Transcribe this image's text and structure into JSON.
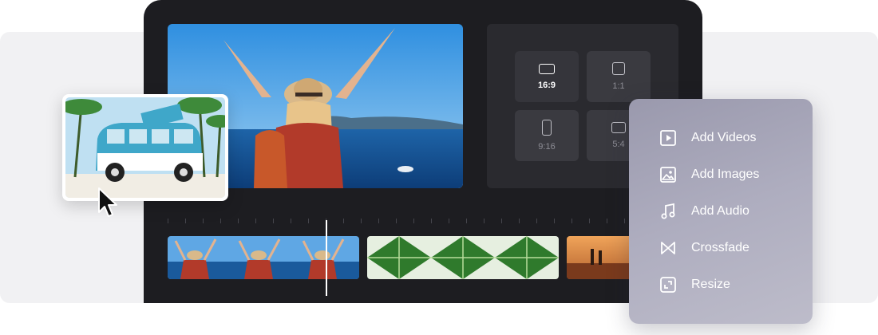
{
  "aspect_ratios": [
    {
      "label": "16:9",
      "icon": "landscape-rectangle-icon",
      "active": true
    },
    {
      "label": "1:1",
      "icon": "square-icon",
      "active": false
    },
    {
      "label": "9:16",
      "icon": "portrait-rectangle-icon",
      "active": false
    },
    {
      "label": "5:4",
      "icon": "rectangle-icon",
      "active": false
    }
  ],
  "menu": {
    "items": [
      {
        "label": "Add Videos",
        "icon": "play-icon"
      },
      {
        "label": "Add Images",
        "icon": "image-icon"
      },
      {
        "label": "Add Audio",
        "icon": "music-note-icon"
      },
      {
        "label": "Crossfade",
        "icon": "crossfade-icon"
      },
      {
        "label": "Resize",
        "icon": "resize-icon"
      }
    ]
  },
  "timeline": {
    "clips": [
      {
        "name": "beach-arms-raised-clip"
      },
      {
        "name": "palm-leaves-clip"
      },
      {
        "name": "sunset-surfers-clip"
      }
    ]
  },
  "colors": {
    "editor_bg": "#1d1d21",
    "panel_bg": "#2a2a2f",
    "menu_bg": "#a9a8bb",
    "accent_text": "#ffffff"
  }
}
